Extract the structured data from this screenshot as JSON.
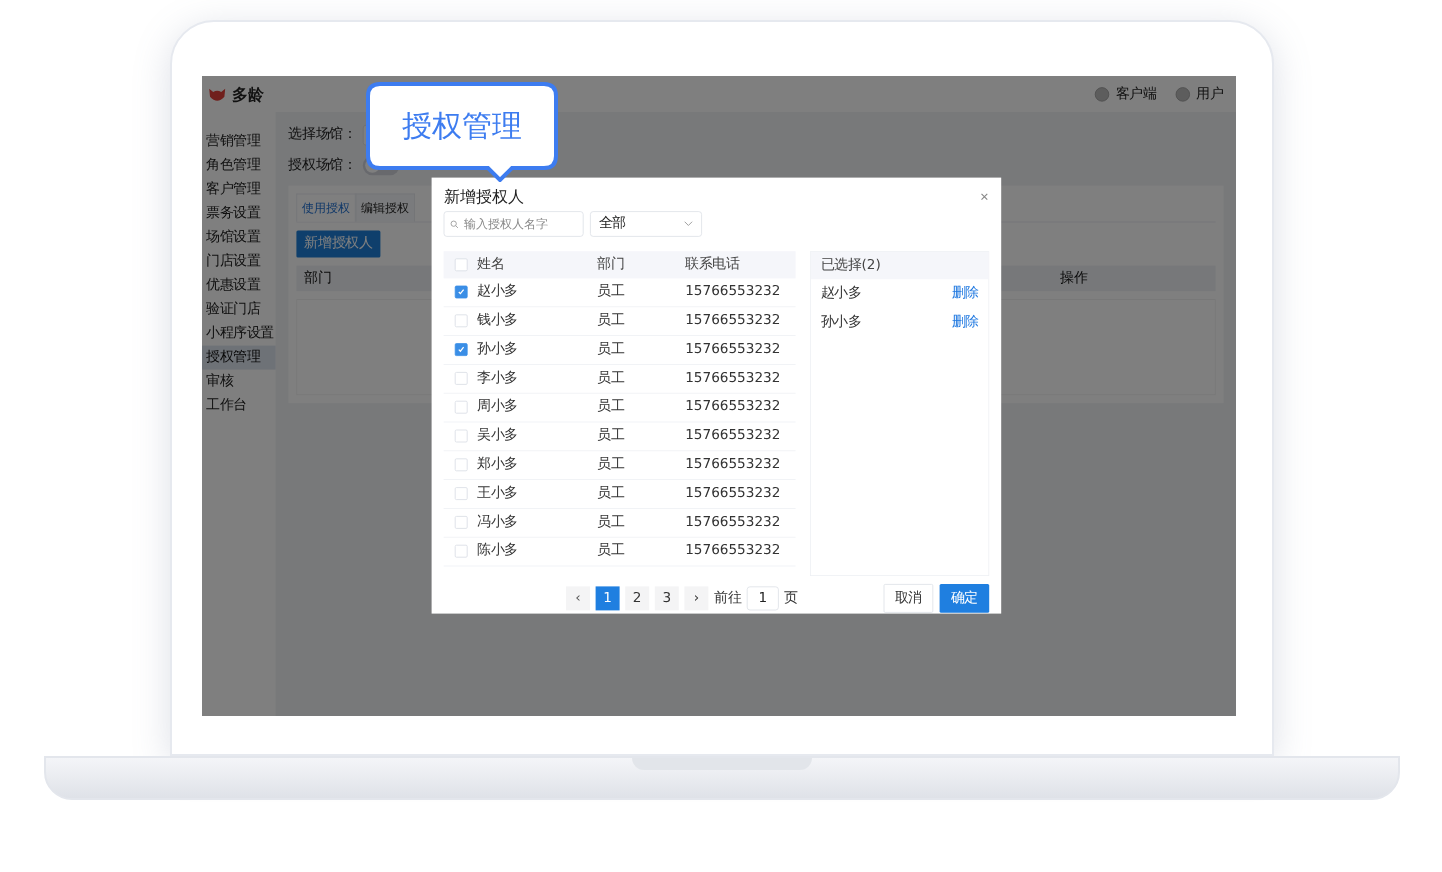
{
  "callout": {
    "label": "授权管理"
  },
  "app": {
    "logo": "多龄",
    "top_actions": [
      {
        "label": "客户端"
      },
      {
        "label": "用户"
      }
    ],
    "sidebar": [
      {
        "label": "营销管理",
        "selected": false
      },
      {
        "label": "角色管理",
        "selected": false
      },
      {
        "label": "客户管理",
        "selected": false
      },
      {
        "label": "票务设置",
        "selected": false
      },
      {
        "label": "场馆设置",
        "selected": false
      },
      {
        "label": "门店设置",
        "selected": false
      },
      {
        "label": "优惠设置",
        "selected": false
      },
      {
        "label": "验证门店",
        "selected": false
      },
      {
        "label": "小程序设置",
        "selected": false
      },
      {
        "label": "授权管理",
        "selected": true
      },
      {
        "label": "审核",
        "selected": false
      },
      {
        "label": "工作台",
        "selected": false
      }
    ],
    "venue_label": "选择场馆：",
    "auth_label": "授权场馆：",
    "auth_toggle": {
      "on": false
    },
    "tabs": [
      {
        "label": "使用授权",
        "selected": true
      },
      {
        "label": "编辑授权",
        "selected": false
      }
    ],
    "add_button": "新增授权人",
    "table_columns": [
      "部门",
      "操作"
    ]
  },
  "dialog": {
    "title": "新增授权人",
    "search": {
      "placeholder": "输入授权人名字"
    },
    "filter": {
      "value": "全部"
    },
    "columns": [
      "姓名",
      "部门",
      "联系电话"
    ],
    "all_checked": false,
    "rows": [
      {
        "name": "赵小多",
        "dept": "员工",
        "phone": "15766553232",
        "checked": true
      },
      {
        "name": "钱小多",
        "dept": "员工",
        "phone": "15766553232",
        "checked": false
      },
      {
        "name": "孙小多",
        "dept": "员工",
        "phone": "15766553232",
        "checked": true
      },
      {
        "name": "李小多",
        "dept": "员工",
        "phone": "15766553232",
        "checked": false
      },
      {
        "name": "周小多",
        "dept": "员工",
        "phone": "15766553232",
        "checked": false
      },
      {
        "name": "吴小多",
        "dept": "员工",
        "phone": "15766553232",
        "checked": false
      },
      {
        "name": "郑小多",
        "dept": "员工",
        "phone": "15766553232",
        "checked": false
      },
      {
        "name": "王小多",
        "dept": "员工",
        "phone": "15766553232",
        "checked": false
      },
      {
        "name": "冯小多",
        "dept": "员工",
        "phone": "15766553232",
        "checked": false
      },
      {
        "name": "陈小多",
        "dept": "员工",
        "phone": "15766553232",
        "checked": false
      }
    ],
    "selected_title": "已选择(2)",
    "selected_people": [
      {
        "name": "赵小多",
        "action": "删除"
      },
      {
        "name": "孙小多",
        "action": "删除"
      }
    ],
    "pagination": {
      "prev": "‹",
      "pages": [
        {
          "label": "1",
          "selected": true
        },
        {
          "label": "2",
          "selected": false
        },
        {
          "label": "3",
          "selected": false
        }
      ],
      "next": "›",
      "goto": "前往",
      "page_value": "1",
      "page_suffix": "页"
    },
    "buttons": [
      {
        "label": "取消",
        "kind": "secondary"
      },
      {
        "label": "确定",
        "kind": "primary"
      }
    ]
  }
}
